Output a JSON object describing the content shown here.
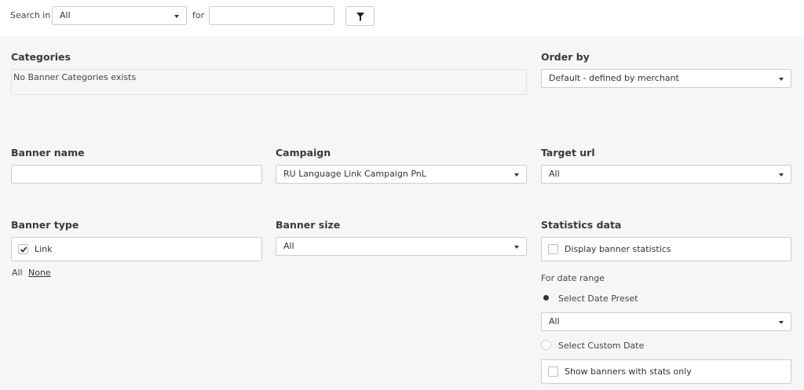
{
  "search": {
    "search_in_label": "Search in",
    "scope_value": "All",
    "for_label": "for",
    "query_value": "",
    "filter_icon": "filter-icon"
  },
  "categories": {
    "heading": "Categories",
    "empty_text": "No Banner Categories exists"
  },
  "order_by": {
    "heading": "Order by",
    "value": "Default - defined by merchant"
  },
  "banner_name": {
    "heading": "Banner name",
    "value": ""
  },
  "campaign": {
    "heading": "Campaign",
    "value": "RU Language Link Campaign PnL"
  },
  "target_url": {
    "heading": "Target url",
    "value": "All"
  },
  "banner_type": {
    "heading": "Banner type",
    "option_label": "Link",
    "option_checked": true,
    "all_link": "All",
    "none_link": "None"
  },
  "banner_size": {
    "heading": "Banner size",
    "value": "All"
  },
  "statistics": {
    "heading": "Statistics data",
    "display_stats_label": "Display banner statistics",
    "date_range_label": "For date range",
    "preset_radio_label": "Select Date Preset",
    "preset_value": "All",
    "custom_radio_label": "Select Custom Date",
    "stats_only_label": "Show banners with stats only"
  }
}
